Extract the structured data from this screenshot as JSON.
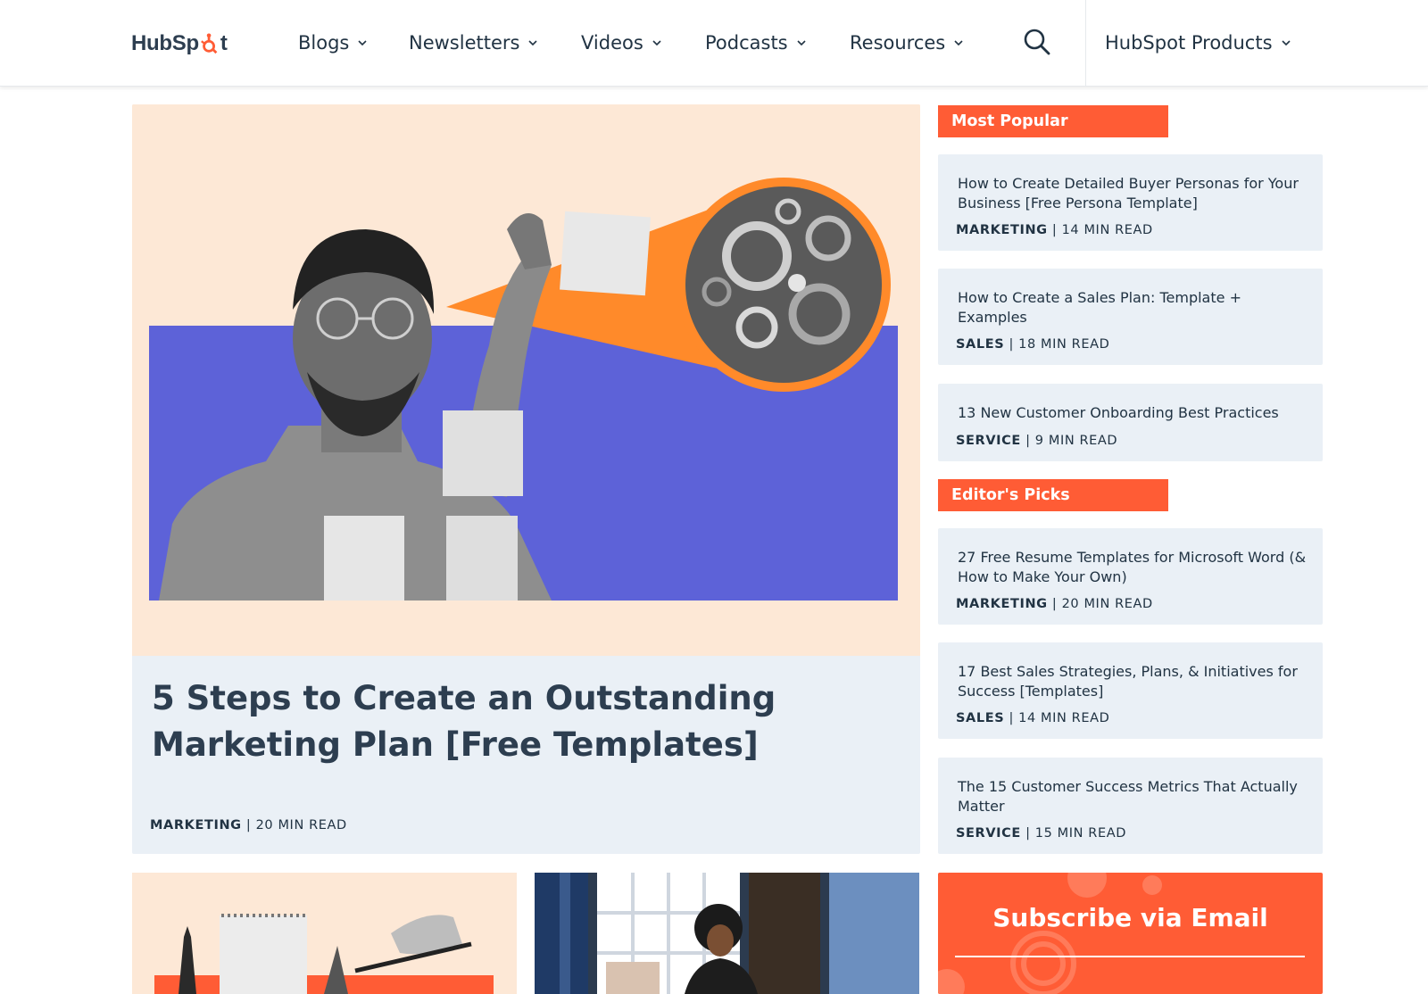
{
  "brand": {
    "logo_text_left": "HubSp",
    "logo_text_right": "t"
  },
  "nav": {
    "items": [
      {
        "label": "Blogs"
      },
      {
        "label": "Newsletters"
      },
      {
        "label": "Videos"
      },
      {
        "label": "Podcasts"
      },
      {
        "label": "Resources"
      }
    ],
    "products_label": "HubSpot Products"
  },
  "featured": {
    "title": "5 Steps to Create an Outstanding Marketing Plan [Free Templates]",
    "category": "MARKETING",
    "read_time": " | 20 MIN READ"
  },
  "sidebar": {
    "most_popular_label": "Most Popular",
    "most_popular": [
      {
        "title": "How to Create Detailed Buyer Personas for Your Business [Free Persona Template]",
        "category": "MARKETING",
        "read_time": " | 14 MIN READ"
      },
      {
        "title": "How to Create a Sales Plan: Template + Examples",
        "category": "SALES",
        "read_time": " | 18 MIN READ"
      },
      {
        "title": "13 New Customer Onboarding Best Practices",
        "category": "SERVICE",
        "read_time": " | 9 MIN READ"
      }
    ],
    "editors_picks_label": "Editor's Picks",
    "editors_picks": [
      {
        "title": "27 Free Resume Templates for Microsoft Word (& How to Make Your Own)",
        "category": "MARKETING",
        "read_time": " | 20 MIN READ"
      },
      {
        "title": "17 Best Sales Strategies, Plans, & Initiatives for Success [Templates]",
        "category": "SALES",
        "read_time": " | 14 MIN READ"
      },
      {
        "title": "The 15 Customer Success Metrics That Actually Matter",
        "category": "SERVICE",
        "read_time": " | 15 MIN READ"
      }
    ]
  },
  "subscribe": {
    "title": "Subscribe via Email"
  },
  "colors": {
    "accent": "#ff5c35",
    "card_bg": "#eaf0f6",
    "text": "#213343",
    "peach": "#fde8d6",
    "indigo": "#5d62d8",
    "orange": "#ff8a2a"
  }
}
